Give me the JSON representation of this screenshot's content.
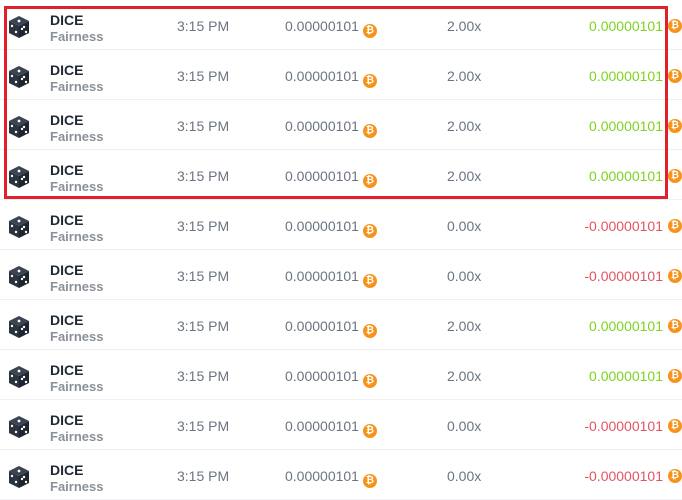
{
  "colors": {
    "win": "#7ed321",
    "loss": "#e05563",
    "coin": "#f7931a",
    "highlight": "#e0202b"
  },
  "coin_icon": "bitcoin-icon",
  "game_icon": "dice-icon",
  "rows": [
    {
      "game": "DICE",
      "link": "Fairness",
      "time": "3:15 PM",
      "bet": "0.00000101",
      "multiplier": "2.00x",
      "profit": "0.00000101",
      "result": "win"
    },
    {
      "game": "DICE",
      "link": "Fairness",
      "time": "3:15 PM",
      "bet": "0.00000101",
      "multiplier": "2.00x",
      "profit": "0.00000101",
      "result": "win"
    },
    {
      "game": "DICE",
      "link": "Fairness",
      "time": "3:15 PM",
      "bet": "0.00000101",
      "multiplier": "2.00x",
      "profit": "0.00000101",
      "result": "win"
    },
    {
      "game": "DICE",
      "link": "Fairness",
      "time": "3:15 PM",
      "bet": "0.00000101",
      "multiplier": "2.00x",
      "profit": "0.00000101",
      "result": "win"
    },
    {
      "game": "DICE",
      "link": "Fairness",
      "time": "3:15 PM",
      "bet": "0.00000101",
      "multiplier": "0.00x",
      "profit": "-0.00000101",
      "result": "loss"
    },
    {
      "game": "DICE",
      "link": "Fairness",
      "time": "3:15 PM",
      "bet": "0.00000101",
      "multiplier": "0.00x",
      "profit": "-0.00000101",
      "result": "loss"
    },
    {
      "game": "DICE",
      "link": "Fairness",
      "time": "3:15 PM",
      "bet": "0.00000101",
      "multiplier": "2.00x",
      "profit": "0.00000101",
      "result": "win"
    },
    {
      "game": "DICE",
      "link": "Fairness",
      "time": "3:15 PM",
      "bet": "0.00000101",
      "multiplier": "2.00x",
      "profit": "0.00000101",
      "result": "win"
    },
    {
      "game": "DICE",
      "link": "Fairness",
      "time": "3:15 PM",
      "bet": "0.00000101",
      "multiplier": "0.00x",
      "profit": "-0.00000101",
      "result": "loss"
    },
    {
      "game": "DICE",
      "link": "Fairness",
      "time": "3:15 PM",
      "bet": "0.00000101",
      "multiplier": "0.00x",
      "profit": "-0.00000101",
      "result": "loss"
    }
  ]
}
